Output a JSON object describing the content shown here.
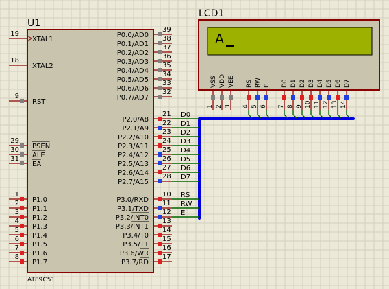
{
  "colors": {
    "background": "#ece9d8",
    "grid": "#d4d0c0",
    "body_fill": "#c8c4ae",
    "body_stroke": "#8b0000",
    "wire": "#8b0000",
    "bus": "#0000e0",
    "net_wire": "#006400",
    "lcd_screen": "#9db200",
    "lcd_text": "#000000",
    "pin_red": "#e02020",
    "pin_blue": "#2040e0",
    "pin_gray": "#808080"
  },
  "mcu": {
    "ref": "U1",
    "part": "AT89C51",
    "left_pins": [
      {
        "num": "19",
        "name": "XTAL1",
        "state": "none",
        "clock": true
      },
      {
        "num": "18",
        "name": "XTAL2",
        "state": "none"
      },
      {
        "num": "9",
        "name": "RST",
        "state": "gray"
      },
      {
        "num": "29",
        "name": "PSEN",
        "state": "gray",
        "overline": true
      },
      {
        "num": "30",
        "name": "ALE",
        "state": "gray",
        "overline": true
      },
      {
        "num": "31",
        "name": "EA",
        "state": "gray",
        "overline": true
      },
      {
        "num": "1",
        "name": "P1.0",
        "state": "red"
      },
      {
        "num": "2",
        "name": "P1.1",
        "state": "red"
      },
      {
        "num": "3",
        "name": "P1.2",
        "state": "red"
      },
      {
        "num": "4",
        "name": "P1.3",
        "state": "red"
      },
      {
        "num": "5",
        "name": "P1.4",
        "state": "red"
      },
      {
        "num": "6",
        "name": "P1.5",
        "state": "red"
      },
      {
        "num": "7",
        "name": "P1.6",
        "state": "red"
      },
      {
        "num": "8",
        "name": "P1.7",
        "state": "red"
      }
    ],
    "right_pins": [
      {
        "num": "39",
        "name": "P0.0/AD0",
        "state": "gray"
      },
      {
        "num": "38",
        "name": "P0.1/AD1",
        "state": "gray"
      },
      {
        "num": "37",
        "name": "P0.2/AD2",
        "state": "gray"
      },
      {
        "num": "36",
        "name": "P0.3/AD3",
        "state": "gray"
      },
      {
        "num": "35",
        "name": "P0.4/AD4",
        "state": "gray"
      },
      {
        "num": "34",
        "name": "P0.5/AD5",
        "state": "gray"
      },
      {
        "num": "33",
        "name": "P0.6/AD6",
        "state": "gray"
      },
      {
        "num": "32",
        "name": "P0.7/AD7",
        "state": "gray"
      },
      {
        "num": "21",
        "name": "P2.0/A8",
        "state": "red",
        "net": "D0"
      },
      {
        "num": "22",
        "name": "P2.1/A9",
        "state": "blue",
        "net": "D1"
      },
      {
        "num": "23",
        "name": "P2.2/A10",
        "state": "red",
        "net": "D2"
      },
      {
        "num": "24",
        "name": "P2.3/A11",
        "state": "red",
        "net": "D3"
      },
      {
        "num": "25",
        "name": "P2.4/A12",
        "state": "blue",
        "net": "D4"
      },
      {
        "num": "26",
        "name": "P2.5/A13",
        "state": "blue",
        "net": "D5"
      },
      {
        "num": "27",
        "name": "P2.6/A14",
        "state": "red",
        "net": "D6"
      },
      {
        "num": "28",
        "name": "P2.7/A15",
        "state": "blue",
        "net": "D7"
      },
      {
        "num": "10",
        "name": "P3.0/RXD",
        "state": "red",
        "net": "RS"
      },
      {
        "num": "11",
        "name": "P3.1/TXD",
        "state": "blue",
        "net": "RW"
      },
      {
        "num": "12",
        "name": "P3.2/INT0",
        "state": "blue",
        "net": "E",
        "overline_part": "INT0"
      },
      {
        "num": "13",
        "name": "P3.3/INT1",
        "state": "red",
        "overline_part": "INT1"
      },
      {
        "num": "14",
        "name": "P3.4/T0",
        "state": "red"
      },
      {
        "num": "15",
        "name": "P3.5/T1",
        "state": "red"
      },
      {
        "num": "16",
        "name": "P3.6/WR",
        "state": "red",
        "overline_part": "WR"
      },
      {
        "num": "17",
        "name": "P3.7/RD",
        "state": "red",
        "overline_part": "RD"
      }
    ]
  },
  "lcd": {
    "ref": "LCD1",
    "display_text": "A",
    "pins": [
      {
        "num": "1",
        "name": "VSS",
        "state": "gray"
      },
      {
        "num": "2",
        "name": "VDD",
        "state": "gray"
      },
      {
        "num": "3",
        "name": "VEE",
        "state": "gray"
      },
      {
        "num": "4",
        "name": "RS",
        "state": "red"
      },
      {
        "num": "5",
        "name": "RW",
        "state": "blue"
      },
      {
        "num": "6",
        "name": "E",
        "state": "blue"
      },
      {
        "num": "7",
        "name": "D0",
        "state": "red"
      },
      {
        "num": "8",
        "name": "D1",
        "state": "blue"
      },
      {
        "num": "9",
        "name": "D2",
        "state": "red"
      },
      {
        "num": "10",
        "name": "D3",
        "state": "red"
      },
      {
        "num": "11",
        "name": "D4",
        "state": "blue"
      },
      {
        "num": "12",
        "name": "D5",
        "state": "blue"
      },
      {
        "num": "13",
        "name": "D6",
        "state": "red"
      },
      {
        "num": "14",
        "name": "D7",
        "state": "blue"
      }
    ]
  }
}
